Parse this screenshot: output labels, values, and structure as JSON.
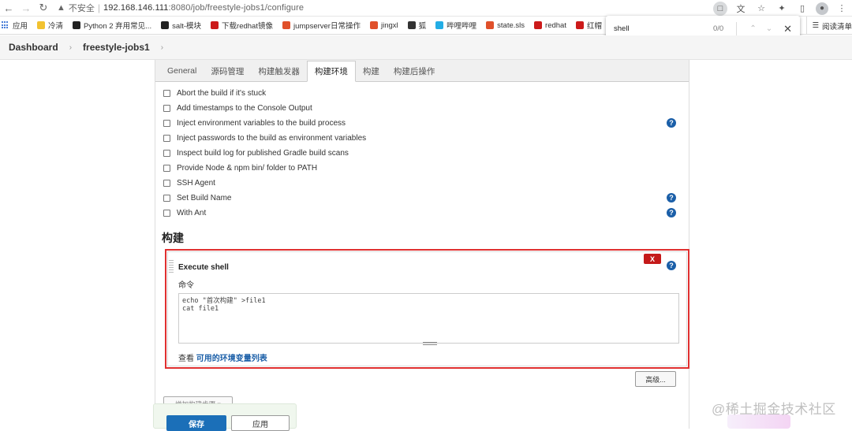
{
  "browser": {
    "security_label": "不安全",
    "url_host": "192.168.146.111",
    "url_path": ":8080/job/freestyle-jobs1/configure"
  },
  "bookmarks": {
    "items": [
      {
        "label": "应用",
        "color": "#4a7fd8"
      },
      {
        "label": "冷清",
        "color": "#f2c230"
      },
      {
        "label": "Python 2 弃用常见...",
        "color": "#222222"
      },
      {
        "label": "salt-模块",
        "color": "#222222"
      },
      {
        "label": "下载redhat镜像",
        "color": "#cc1a1a"
      },
      {
        "label": "jumpserver日常操作",
        "color": "#e0502a"
      },
      {
        "label": "jingxl",
        "color": "#e0502a"
      },
      {
        "label": "狐",
        "color": "#333333"
      },
      {
        "label": "哔哩哔哩",
        "color": "#23ade5"
      },
      {
        "label": "state.sls",
        "color": "#e0502a"
      },
      {
        "label": "redhat",
        "color": "#cc1a1a"
      },
      {
        "label": "红帽",
        "color": "#cc1a1a"
      }
    ],
    "reading_list": "阅读清单"
  },
  "findbar": {
    "query": "shell",
    "count": "0/0"
  },
  "breadcrumbs": {
    "dashboard": "Dashboard",
    "job": "freestyle-jobs1"
  },
  "tabs": [
    {
      "label": "General"
    },
    {
      "label": "源码管理"
    },
    {
      "label": "构建触发器"
    },
    {
      "label": "构建环境"
    },
    {
      "label": "构建"
    },
    {
      "label": "构建后操作"
    }
  ],
  "build_env_options": [
    {
      "label": "Abort the build if it's stuck",
      "help": false
    },
    {
      "label": "Add timestamps to the Console Output",
      "help": false
    },
    {
      "label": "Inject environment variables to the build process",
      "help": true
    },
    {
      "label": "Inject passwords to the build as environment variables",
      "help": false
    },
    {
      "label": "Inspect build log for published Gradle build scans",
      "help": false
    },
    {
      "label": "Provide Node & npm bin/ folder to PATH",
      "help": false
    },
    {
      "label": "SSH Agent",
      "help": false
    },
    {
      "label": "Set Build Name",
      "help": true
    },
    {
      "label": "With Ant",
      "help": true
    }
  ],
  "build": {
    "section_title": "构建",
    "step_title": "Execute shell",
    "delete_label": "X",
    "command_label": "命令",
    "command_lines": [
      "echo \"首次构建\" >file1",
      "cat file1"
    ],
    "env_prefix": "查看 ",
    "env_link": "可用的环境变量列表",
    "advanced_label": "高级...",
    "add_step_label": "增加构建步骤 ▾"
  },
  "actions": {
    "save": "保存",
    "apply": "应用"
  },
  "watermark": "@稀土掘金技术社区",
  "colors": {
    "accent": "#1b5fa8",
    "danger": "#c41a1a",
    "highlight_border": "#e03030"
  }
}
